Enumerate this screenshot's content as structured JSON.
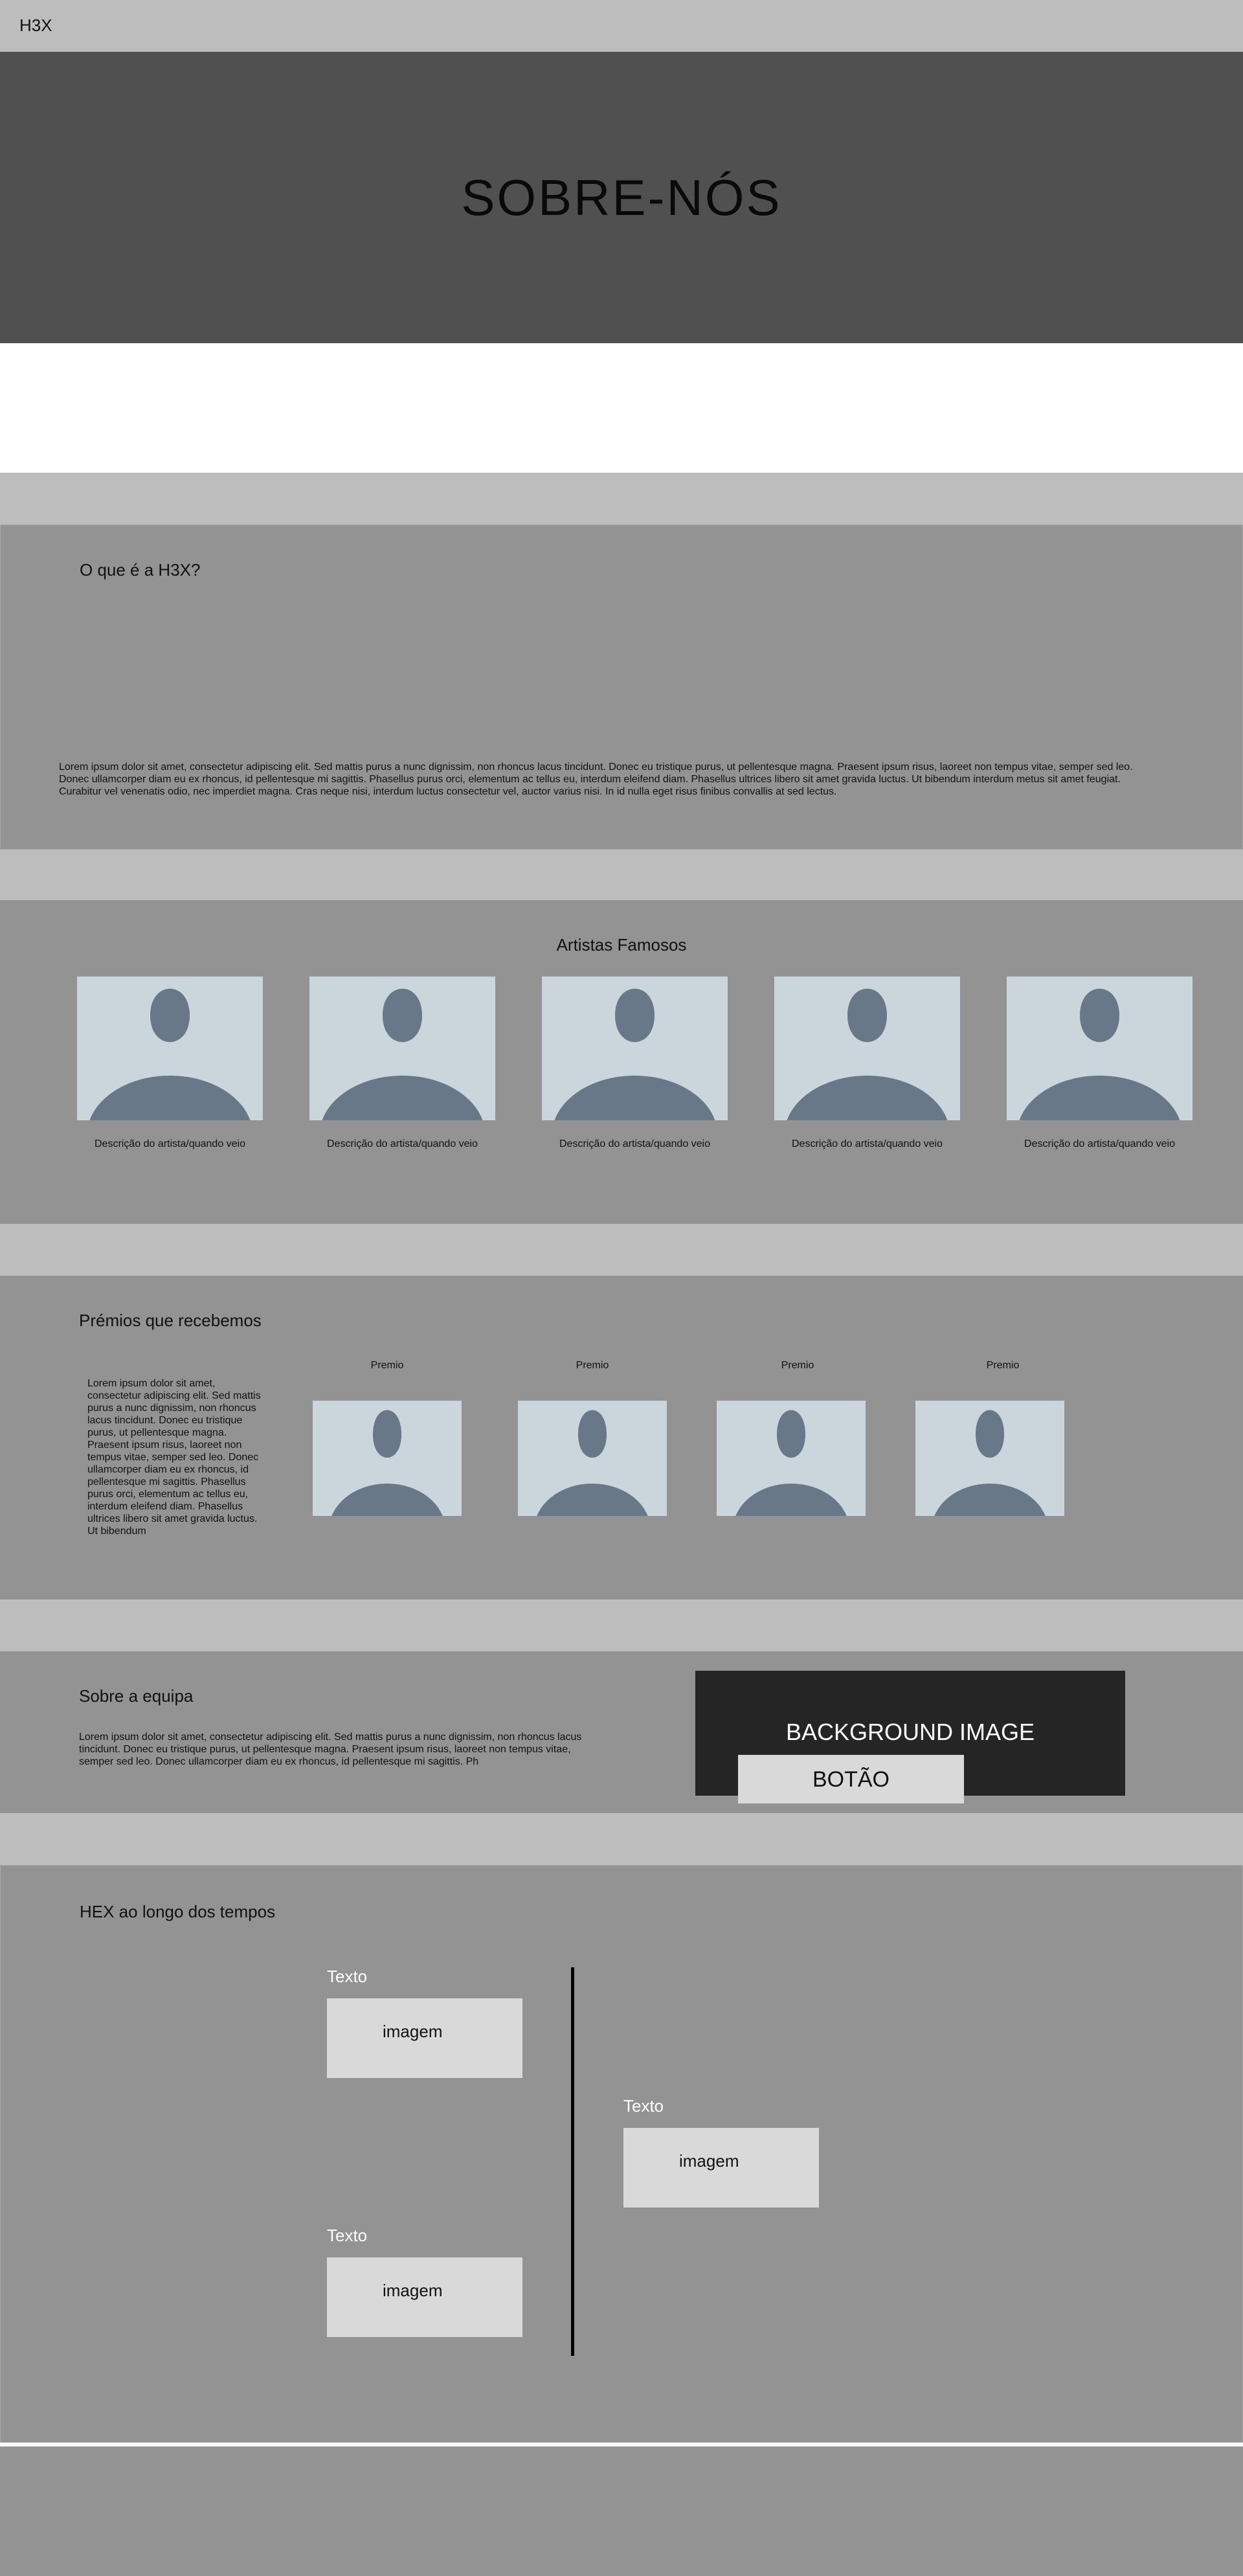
{
  "header": {
    "logo": "H3X"
  },
  "hero": {
    "title": "SOBRE-NÓS"
  },
  "about": {
    "heading": "O que é a H3X?",
    "text": "Lorem ipsum dolor sit amet, consectetur adipiscing elit. Sed mattis  purus a nunc dignissim, non rhoncus lacus tincidunt. Donec eu tristique  purus, ut pellentesque magna. Praesent ipsum risus, laoreet non tempus  vitae, semper sed leo. Donec ullamcorper diam eu ex rhoncus, id  pellentesque mi sagittis. Phasellus purus orci, elementum ac tellus eu,  interdum eleifend diam. Phasellus ultrices libero sit amet gravida  luctus. Ut bibendum interdum metus sit amet feugiat. Curabitur vel  venenatis odio, nec imperdiet magna. Cras neque nisi, interdum luctus  consectetur vel, auctor varius nisi. In id nulla eget risus finibus  convallis at sed lectus."
  },
  "artists": {
    "heading": "Artistas Famosos",
    "items": [
      {
        "caption": "Descrição do artista/quando veio"
      },
      {
        "caption": "Descrição do artista/quando veio"
      },
      {
        "caption": "Descrição do artista/quando veio"
      },
      {
        "caption": "Descrição do artista/quando veio"
      },
      {
        "caption": "Descrição do artista/quando veio"
      }
    ]
  },
  "awards": {
    "heading": "Prémios que recebemos",
    "text": "Lorem ipsum dolor sit amet, consectetur adipiscing elit. Sed mattis  purus a nunc dignissim, non rhoncus lacus tincidunt. Donec eu tristique  purus, ut pellentesque magna. Praesent ipsum risus, laoreet non tempus  vitae, semper sed leo. Donec ullamcorper diam eu ex rhoncus, id  pellentesque mi sagittis. Phasellus purus orci, elementum ac tellus eu,  interdum eleifend diam. Phasellus ultrices libero sit amet gravida  luctus. Ut bibendum",
    "items": [
      {
        "label": "Premio"
      },
      {
        "label": "Premio"
      },
      {
        "label": "Premio"
      },
      {
        "label": "Premio"
      }
    ]
  },
  "team": {
    "heading": "Sobre a equipa",
    "text": "Lorem ipsum dolor sit amet, consectetur adipiscing elit. Sed mattis  purus a nunc dignissim, non rhoncus lacus tincidunt. Donec eu tristique  purus, ut pellentesque magna. Praesent ipsum risus, laoreet non tempus  vitae, semper sed leo. Donec ullamcorper diam eu ex rhoncus, id  pellentesque mi sagittis. Ph",
    "background_label": "BACKGROUND IMAGE",
    "button_label": "BOTÃO"
  },
  "timeline": {
    "heading": "HEX ao longo dos tempos",
    "items": [
      {
        "title": "Texto",
        "image_label": "imagem"
      },
      {
        "title": "Texto",
        "image_label": "imagem"
      },
      {
        "title": "Texto",
        "image_label": "imagem"
      }
    ]
  },
  "colors": {
    "header_bg": "#bdbdbd",
    "hero_bg": "#505050",
    "panel_bg": "#939393",
    "avatar_bg": "#cbd5dc",
    "avatar_fg": "#687888",
    "dark_card": "#252525",
    "light_box": "#d9d9d9"
  }
}
